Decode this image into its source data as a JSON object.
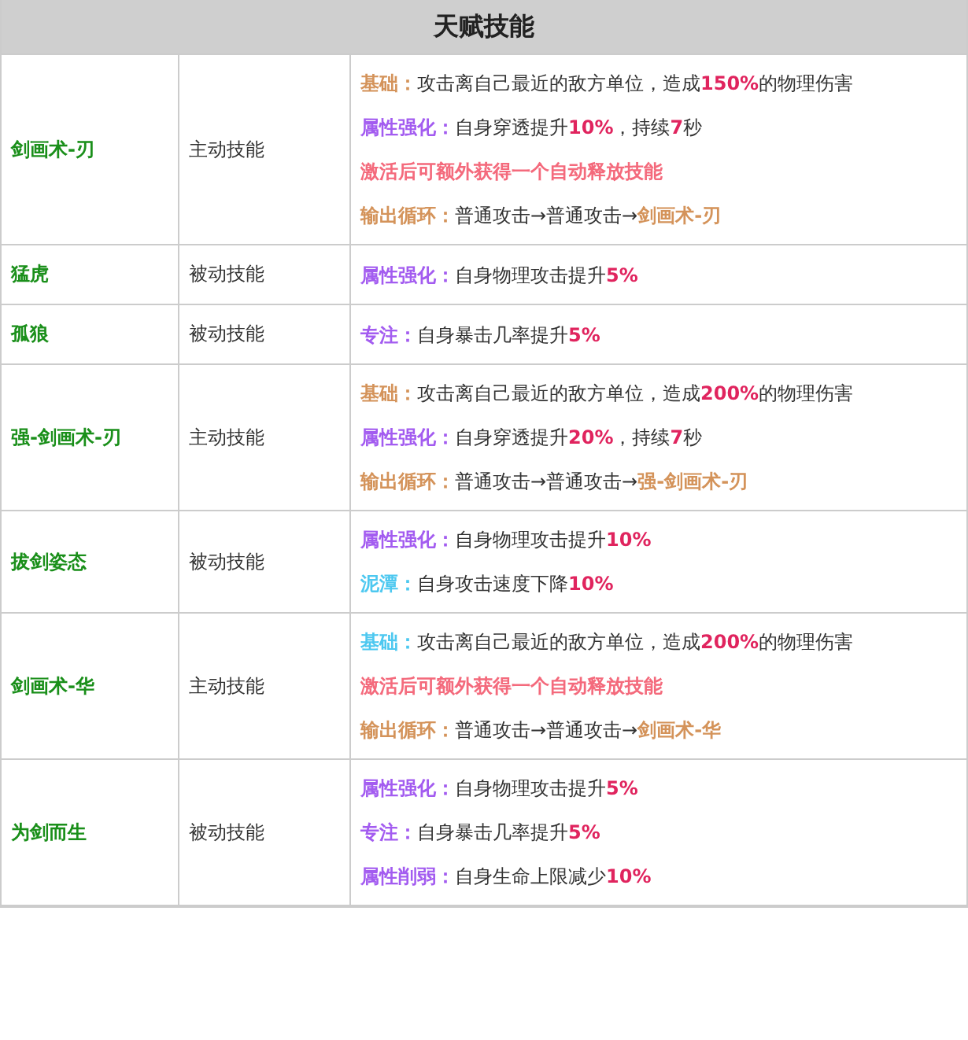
{
  "title": "天赋技能",
  "rows": [
    {
      "name": "剑画术-刃",
      "type": "主动技能",
      "lines": [
        {
          "kind": "effect",
          "label": "基础：",
          "color": "#d4935a",
          "text": "攻击离自己最近的敌方单位，造成**150%**的物理伤害"
        },
        {
          "kind": "effect",
          "label": "属性强化：",
          "color": "#a35cf0",
          "text": "自身穿透提升**10%**，持续**7**秒"
        },
        {
          "kind": "note",
          "text": "激活后可额外获得一个自动释放技能"
        },
        {
          "kind": "cycle",
          "label": "输出循环：",
          "color": "#d4935a",
          "text": "普通攻击→普通攻击→**剑画术-刃**"
        }
      ]
    },
    {
      "name": "猛虎",
      "type": "被动技能",
      "lines": [
        {
          "kind": "effect",
          "label": "属性强化：",
          "color": "#a35cf0",
          "text": "自身物理攻击提升**5%**"
        }
      ]
    },
    {
      "name": "孤狼",
      "type": "被动技能",
      "lines": [
        {
          "kind": "effect",
          "label": "专注：",
          "color": "#a35cf0",
          "text": "自身暴击几率提升**5%**"
        }
      ]
    },
    {
      "name": "强-剑画术-刃",
      "type": "主动技能",
      "lines": [
        {
          "kind": "effect",
          "label": "基础：",
          "color": "#d4935a",
          "text": "攻击离自己最近的敌方单位，造成**200%**的物理伤害"
        },
        {
          "kind": "effect",
          "label": "属性强化：",
          "color": "#a35cf0",
          "text": "自身穿透提升**20%**，持续**7**秒"
        },
        {
          "kind": "cycle",
          "label": "输出循环：",
          "color": "#d4935a",
          "text": "普通攻击→普通攻击→**强-剑画术-刃**"
        }
      ]
    },
    {
      "name": "拔剑姿态",
      "type": "被动技能",
      "lines": [
        {
          "kind": "effect",
          "label": "属性强化：",
          "color": "#a35cf0",
          "text": "自身物理攻击提升**10%**"
        },
        {
          "kind": "effect",
          "label": "泥潭：",
          "color": "#4dc8f0",
          "text": "自身攻击速度下降**10%**"
        }
      ]
    },
    {
      "name": "剑画术-华",
      "type": "主动技能",
      "lines": [
        {
          "kind": "effect",
          "label": "基础：",
          "color": "#4dc8f0",
          "text": "攻击离自己最近的敌方单位，造成**200%**的物理伤害"
        },
        {
          "kind": "note",
          "text": "激活后可额外获得一个自动释放技能"
        },
        {
          "kind": "cycle",
          "label": "输出循环：",
          "color": "#d4935a",
          "text": "普通攻击→普通攻击→**剑画术-华**"
        }
      ]
    },
    {
      "name": "为剑而生",
      "type": "被动技能",
      "lines": [
        {
          "kind": "effect",
          "label": "属性强化：",
          "color": "#a35cf0",
          "text": "自身物理攻击提升**5%**"
        },
        {
          "kind": "effect",
          "label": "专注：",
          "color": "#a35cf0",
          "text": "自身暴击几率提升**5%**"
        },
        {
          "kind": "effect",
          "label": "属性削弱：",
          "color": "#a35cf0",
          "text": "自身生命上限减少**10%**"
        }
      ]
    }
  ]
}
